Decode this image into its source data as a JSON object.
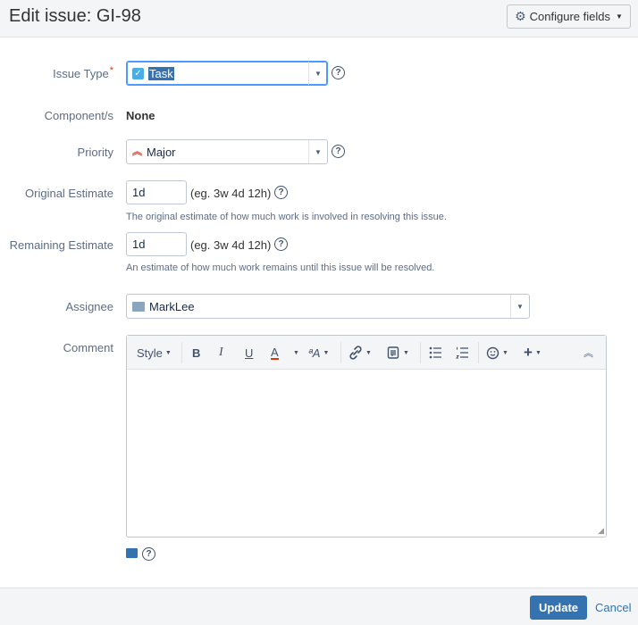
{
  "header": {
    "title": "Edit issue: GI-98",
    "configure_label": "Configure fields"
  },
  "fields": {
    "issue_type": {
      "label": "Issue Type",
      "required_mark": "*",
      "value": "Task"
    },
    "components": {
      "label": "Component/s",
      "value": "None"
    },
    "priority": {
      "label": "Priority",
      "value": "Major"
    },
    "original_estimate": {
      "label": "Original Estimate",
      "value": "1d",
      "hint": "(eg. 3w 4d 12h)",
      "description": "The original estimate of how much work is involved in resolving this issue."
    },
    "remaining_estimate": {
      "label": "Remaining Estimate",
      "value": "1d",
      "hint": "(eg. 3w 4d 12h)",
      "description": "An estimate of how much work remains until this issue will be resolved."
    },
    "assignee": {
      "label": "Assignee",
      "value": "MarkLee"
    },
    "comment": {
      "label": "Comment",
      "value": ""
    }
  },
  "toolbar": {
    "style_label": "Style",
    "bold": "B",
    "italic": "I",
    "underline": "U",
    "text_color": "A",
    "text_effects": "ªA"
  },
  "footer": {
    "update_label": "Update",
    "cancel_label": "Cancel"
  },
  "colors": {
    "accent": "#3572b0",
    "required": "#de350b",
    "priority_major": "#d04437",
    "task_icon": "#4bade8"
  }
}
